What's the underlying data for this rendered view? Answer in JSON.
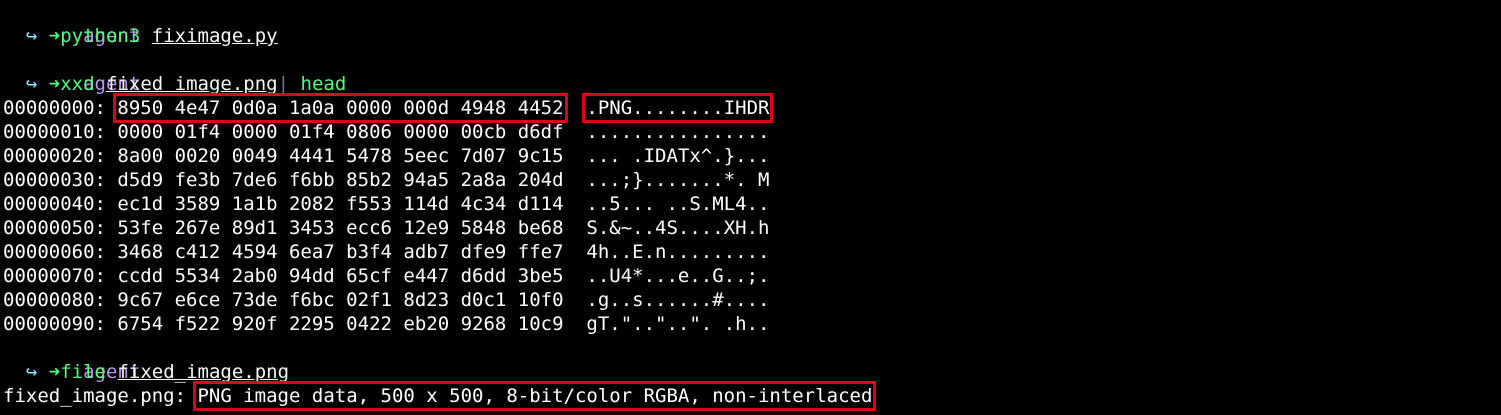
{
  "colors": {
    "background": "#000000",
    "prompt_arrow": "#50fa7b",
    "prompt_dir": "#bd93f9",
    "continuation": "#8be9fd",
    "command": "#50fa7b",
    "highlight_box": "#e0001a"
  },
  "prompt": {
    "arrow": "➜",
    "dir": "agent",
    "continuation": "↪"
  },
  "commands": [
    {
      "name": "python3",
      "arg": "fiximage.py"
    },
    {
      "name": "xxd",
      "arg": "fixed_image.png",
      "pipe": "|",
      "pipe_cmd": "head"
    },
    {
      "name": "file",
      "arg": "fixed_image.png"
    }
  ],
  "hexdump": [
    {
      "offset": "00000000:",
      "hex": "8950 4e47 0d0a 1a0a 0000 000d 4948 4452",
      "ascii": ".PNG........IHDR"
    },
    {
      "offset": "00000010:",
      "hex": "0000 01f4 0000 01f4 0806 0000 00cb d6df",
      "ascii": "................"
    },
    {
      "offset": "00000020:",
      "hex": "8a00 0020 0049 4441 5478 5eec 7d07 9c15",
      "ascii": "... .IDATx^.}..."
    },
    {
      "offset": "00000030:",
      "hex": "d5d9 fe3b 7de6 f6bb 85b2 94a5 2a8a 204d",
      "ascii": "...;}.......*. M"
    },
    {
      "offset": "00000040:",
      "hex": "ec1d 3589 1a1b 2082 f553 114d 4c34 d114",
      "ascii": "..5... ..S.ML4.."
    },
    {
      "offset": "00000050:",
      "hex": "53fe 267e 89d1 3453 ecc6 12e9 5848 be68",
      "ascii": "S.&~..4S....XH.h"
    },
    {
      "offset": "00000060:",
      "hex": "3468 c412 4594 6ea7 b3f4 adb7 dfe9 ffe7",
      "ascii": "4h..E.n........."
    },
    {
      "offset": "00000070:",
      "hex": "ccdd 5534 2ab0 94dd 65cf e447 d6dd 3be5",
      "ascii": "..U4*...e..G..;."
    },
    {
      "offset": "00000080:",
      "hex": "9c67 e6ce 73de f6bc 02f1 8d23 d0c1 10f0",
      "ascii": ".g..s......#...."
    },
    {
      "offset": "00000090:",
      "hex": "6754 f522 920f 2295 0422 eb20 9268 10c9",
      "ascii": "gT.\"..\"..\". .h.."
    }
  ],
  "file_output": {
    "filename": "fixed_image.png:",
    "description": "PNG image data, 500 x 500, 8-bit/color RGBA, non-interlaced"
  }
}
